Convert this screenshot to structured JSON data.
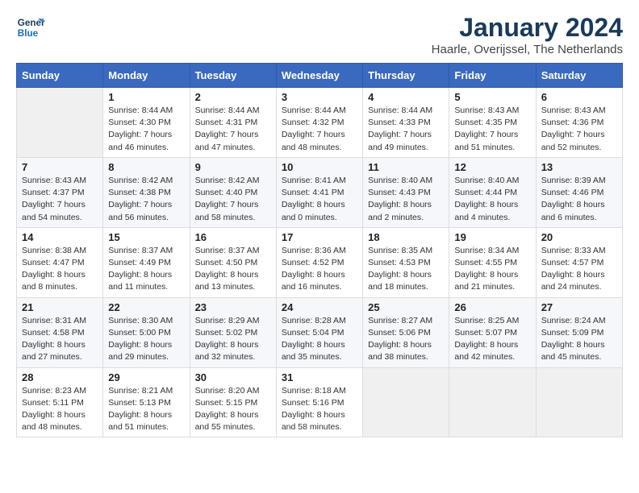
{
  "logo": {
    "line1": "General",
    "line2": "Blue"
  },
  "title": "January 2024",
  "subtitle": "Haarle, Overijssel, The Netherlands",
  "headers": [
    "Sunday",
    "Monday",
    "Tuesday",
    "Wednesday",
    "Thursday",
    "Friday",
    "Saturday"
  ],
  "weeks": [
    [
      {
        "day": "",
        "info": ""
      },
      {
        "day": "1",
        "info": "Sunrise: 8:44 AM\nSunset: 4:30 PM\nDaylight: 7 hours\nand 46 minutes."
      },
      {
        "day": "2",
        "info": "Sunrise: 8:44 AM\nSunset: 4:31 PM\nDaylight: 7 hours\nand 47 minutes."
      },
      {
        "day": "3",
        "info": "Sunrise: 8:44 AM\nSunset: 4:32 PM\nDaylight: 7 hours\nand 48 minutes."
      },
      {
        "day": "4",
        "info": "Sunrise: 8:44 AM\nSunset: 4:33 PM\nDaylight: 7 hours\nand 49 minutes."
      },
      {
        "day": "5",
        "info": "Sunrise: 8:43 AM\nSunset: 4:35 PM\nDaylight: 7 hours\nand 51 minutes."
      },
      {
        "day": "6",
        "info": "Sunrise: 8:43 AM\nSunset: 4:36 PM\nDaylight: 7 hours\nand 52 minutes."
      }
    ],
    [
      {
        "day": "7",
        "info": "Sunrise: 8:43 AM\nSunset: 4:37 PM\nDaylight: 7 hours\nand 54 minutes."
      },
      {
        "day": "8",
        "info": "Sunrise: 8:42 AM\nSunset: 4:38 PM\nDaylight: 7 hours\nand 56 minutes."
      },
      {
        "day": "9",
        "info": "Sunrise: 8:42 AM\nSunset: 4:40 PM\nDaylight: 7 hours\nand 58 minutes."
      },
      {
        "day": "10",
        "info": "Sunrise: 8:41 AM\nSunset: 4:41 PM\nDaylight: 8 hours\nand 0 minutes."
      },
      {
        "day": "11",
        "info": "Sunrise: 8:40 AM\nSunset: 4:43 PM\nDaylight: 8 hours\nand 2 minutes."
      },
      {
        "day": "12",
        "info": "Sunrise: 8:40 AM\nSunset: 4:44 PM\nDaylight: 8 hours\nand 4 minutes."
      },
      {
        "day": "13",
        "info": "Sunrise: 8:39 AM\nSunset: 4:46 PM\nDaylight: 8 hours\nand 6 minutes."
      }
    ],
    [
      {
        "day": "14",
        "info": "Sunrise: 8:38 AM\nSunset: 4:47 PM\nDaylight: 8 hours\nand 8 minutes."
      },
      {
        "day": "15",
        "info": "Sunrise: 8:37 AM\nSunset: 4:49 PM\nDaylight: 8 hours\nand 11 minutes."
      },
      {
        "day": "16",
        "info": "Sunrise: 8:37 AM\nSunset: 4:50 PM\nDaylight: 8 hours\nand 13 minutes."
      },
      {
        "day": "17",
        "info": "Sunrise: 8:36 AM\nSunset: 4:52 PM\nDaylight: 8 hours\nand 16 minutes."
      },
      {
        "day": "18",
        "info": "Sunrise: 8:35 AM\nSunset: 4:53 PM\nDaylight: 8 hours\nand 18 minutes."
      },
      {
        "day": "19",
        "info": "Sunrise: 8:34 AM\nSunset: 4:55 PM\nDaylight: 8 hours\nand 21 minutes."
      },
      {
        "day": "20",
        "info": "Sunrise: 8:33 AM\nSunset: 4:57 PM\nDaylight: 8 hours\nand 24 minutes."
      }
    ],
    [
      {
        "day": "21",
        "info": "Sunrise: 8:31 AM\nSunset: 4:58 PM\nDaylight: 8 hours\nand 27 minutes."
      },
      {
        "day": "22",
        "info": "Sunrise: 8:30 AM\nSunset: 5:00 PM\nDaylight: 8 hours\nand 29 minutes."
      },
      {
        "day": "23",
        "info": "Sunrise: 8:29 AM\nSunset: 5:02 PM\nDaylight: 8 hours\nand 32 minutes."
      },
      {
        "day": "24",
        "info": "Sunrise: 8:28 AM\nSunset: 5:04 PM\nDaylight: 8 hours\nand 35 minutes."
      },
      {
        "day": "25",
        "info": "Sunrise: 8:27 AM\nSunset: 5:06 PM\nDaylight: 8 hours\nand 38 minutes."
      },
      {
        "day": "26",
        "info": "Sunrise: 8:25 AM\nSunset: 5:07 PM\nDaylight: 8 hours\nand 42 minutes."
      },
      {
        "day": "27",
        "info": "Sunrise: 8:24 AM\nSunset: 5:09 PM\nDaylight: 8 hours\nand 45 minutes."
      }
    ],
    [
      {
        "day": "28",
        "info": "Sunrise: 8:23 AM\nSunset: 5:11 PM\nDaylight: 8 hours\nand 48 minutes."
      },
      {
        "day": "29",
        "info": "Sunrise: 8:21 AM\nSunset: 5:13 PM\nDaylight: 8 hours\nand 51 minutes."
      },
      {
        "day": "30",
        "info": "Sunrise: 8:20 AM\nSunset: 5:15 PM\nDaylight: 8 hours\nand 55 minutes."
      },
      {
        "day": "31",
        "info": "Sunrise: 8:18 AM\nSunset: 5:16 PM\nDaylight: 8 hours\nand 58 minutes."
      },
      {
        "day": "",
        "info": ""
      },
      {
        "day": "",
        "info": ""
      },
      {
        "day": "",
        "info": ""
      }
    ]
  ]
}
